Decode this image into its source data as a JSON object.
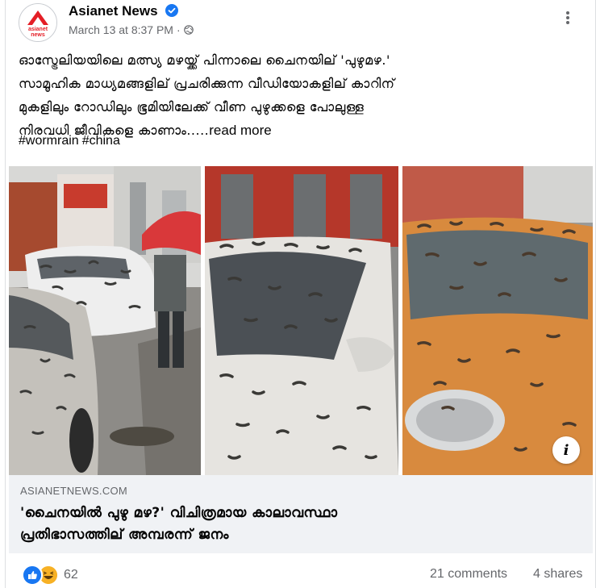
{
  "post": {
    "page_name": "Asianet News",
    "timestamp": "March 13 at 8:37 PM",
    "separator": "·",
    "text_lines": [
      "ഓസ്ട്രേലിയയിലെ മത്സ്യ മഴയ്ക്ക് പിന്നാലെ ചൈനയില് 'പുഴുമഴ.'",
      "സാമൂഹിക മാധ്യമങ്ങളില് പ്രചരിക്കുന്ന വീഡിയോകളില് കാറിന്",
      "മുകളിലും റോഡിലും ഭൂമിയിലേക്ക് വീണ പുഴുക്കളെ പോലുള്ള",
      "നിരവധി ജീവികളെ കാണാം....."
    ],
    "read_more": "read more",
    "hashtags": [
      "#wormrain",
      "#china"
    ]
  },
  "logo": {
    "text_top": "asianet",
    "text_bottom": "news",
    "brand_color": "#e41e26"
  },
  "link_preview": {
    "domain": "ASIANETNEWS.COM",
    "title_lines": [
      "'ചൈനയിൽ പുഴു മഴ?' വിചിത്രമായ കാലാവസ്ഥാ",
      "പ്രതിഭാസത്തില് അമ്പരന്ന് ജനം"
    ],
    "info_glyph": "i"
  },
  "footer": {
    "reaction_count": "62",
    "comments": "21 comments",
    "shares": "4 shares"
  },
  "colors": {
    "verified": "#1877f2",
    "muted_text": "#65676b",
    "preview_bg": "#f0f2f5"
  },
  "icons": {
    "verified": "verified-badge-icon",
    "globe": "globe-icon",
    "more": "more-options-icon",
    "like": "like-reaction-icon",
    "haha": "haha-reaction-icon",
    "info": "info-icon"
  }
}
